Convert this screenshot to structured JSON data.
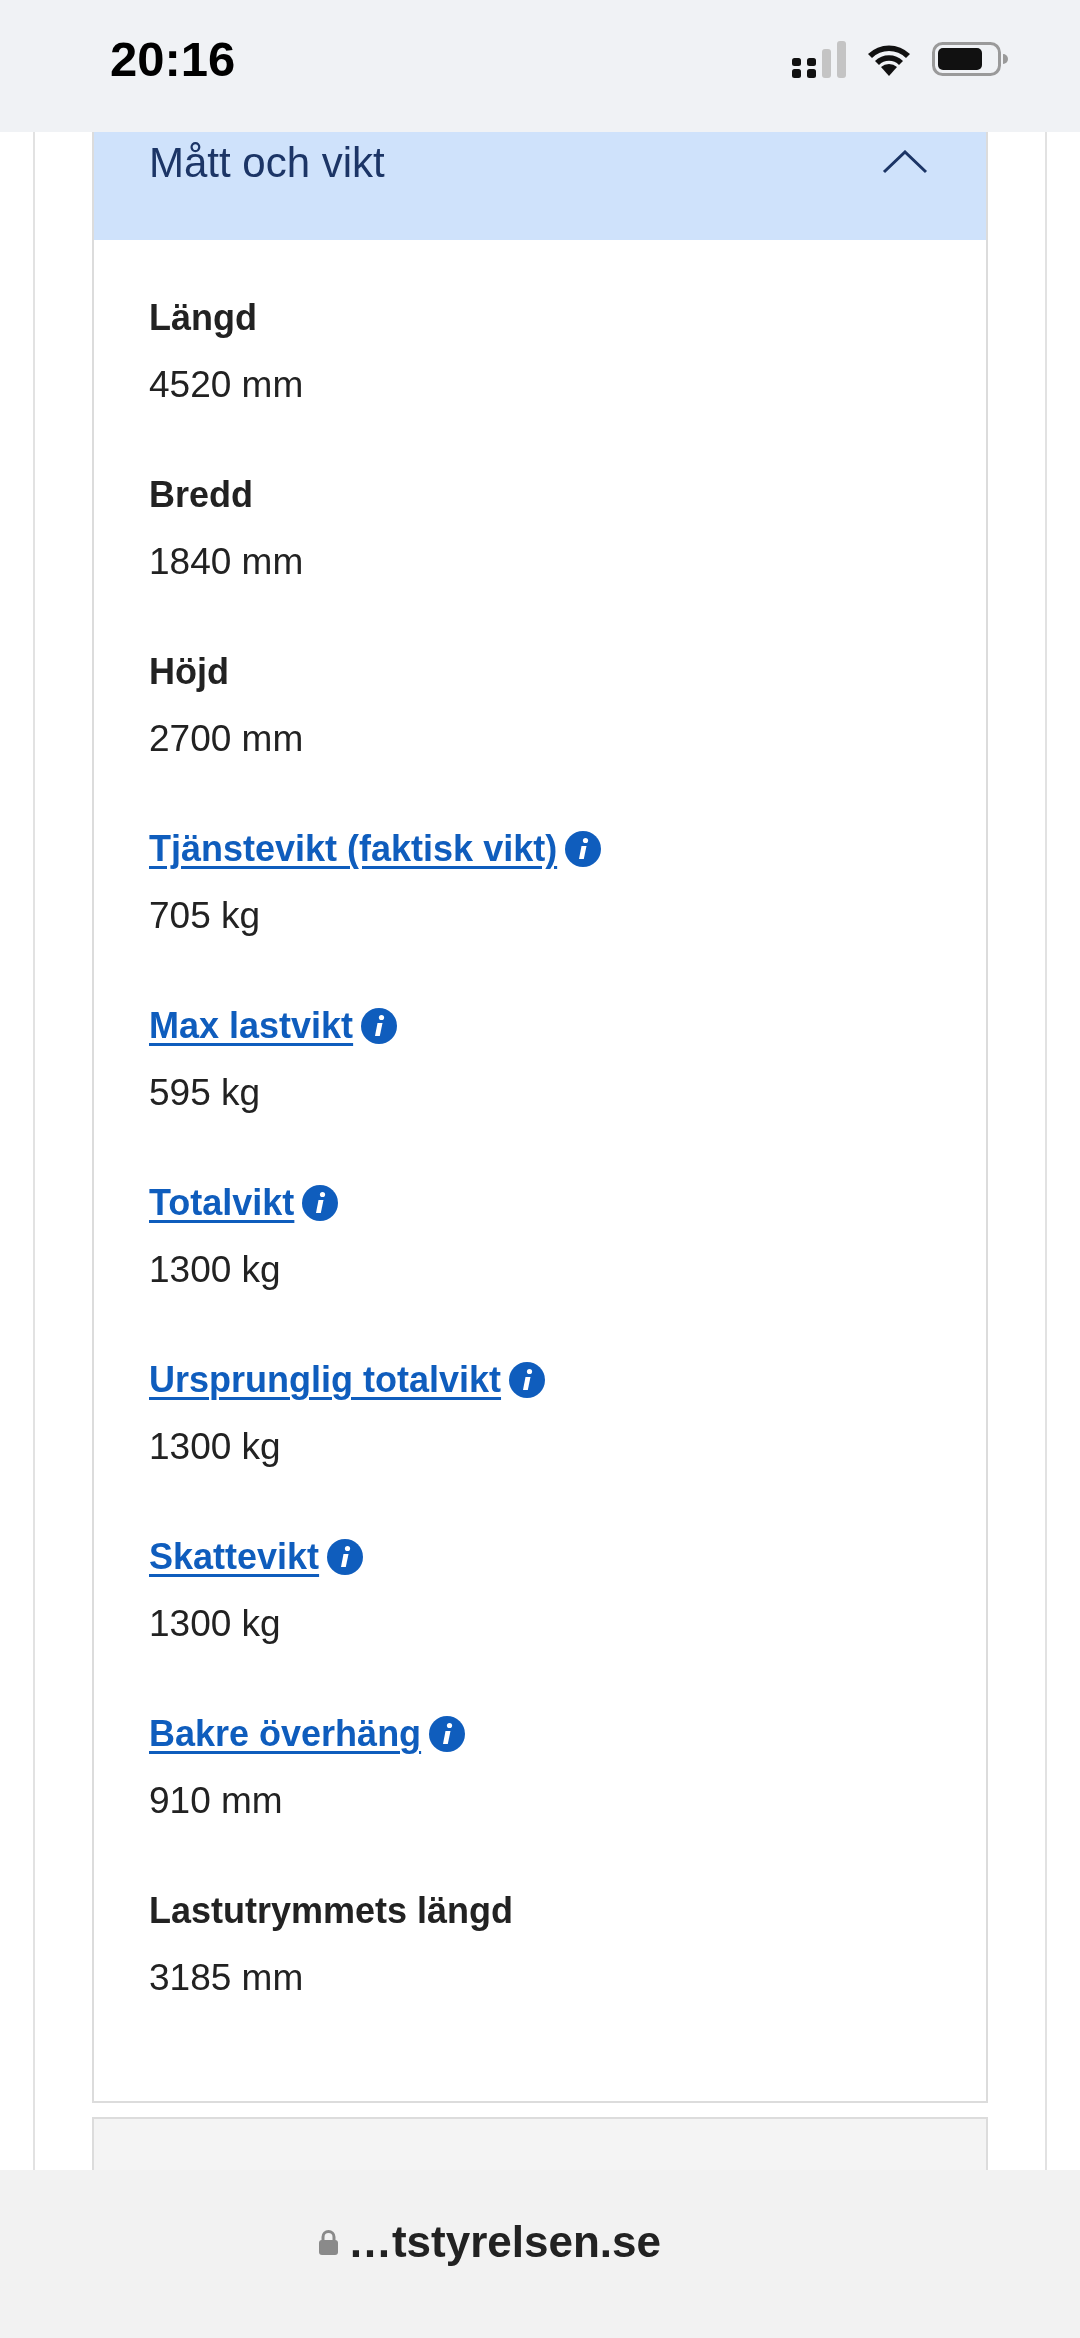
{
  "status_bar": {
    "time": "20:16"
  },
  "section": {
    "title": "Mått och vikt",
    "expanded": true,
    "items": [
      {
        "kind": "text",
        "label": "Längd",
        "value": "4520 mm"
      },
      {
        "kind": "text",
        "label": "Bredd",
        "value": "1840 mm"
      },
      {
        "kind": "text",
        "label": "Höjd",
        "value": "2700 mm"
      },
      {
        "kind": "link",
        "label": "Tjänstevikt (faktisk vikt)",
        "value": "705 kg"
      },
      {
        "kind": "link",
        "label": "Max lastvikt",
        "value": "595 kg"
      },
      {
        "kind": "link",
        "label": "Totalvikt",
        "value": "1300 kg"
      },
      {
        "kind": "link",
        "label": "Ursprunglig totalvikt",
        "value": "1300 kg"
      },
      {
        "kind": "link",
        "label": "Skattevikt",
        "value": "1300 kg"
      },
      {
        "kind": "link",
        "label": "Bakre överhäng",
        "value": "910 mm"
      },
      {
        "kind": "text",
        "label": "Lastutrymmets längd",
        "value": "3185 mm"
      }
    ]
  },
  "address_bar": {
    "url": "…tstyrelsen.se"
  }
}
